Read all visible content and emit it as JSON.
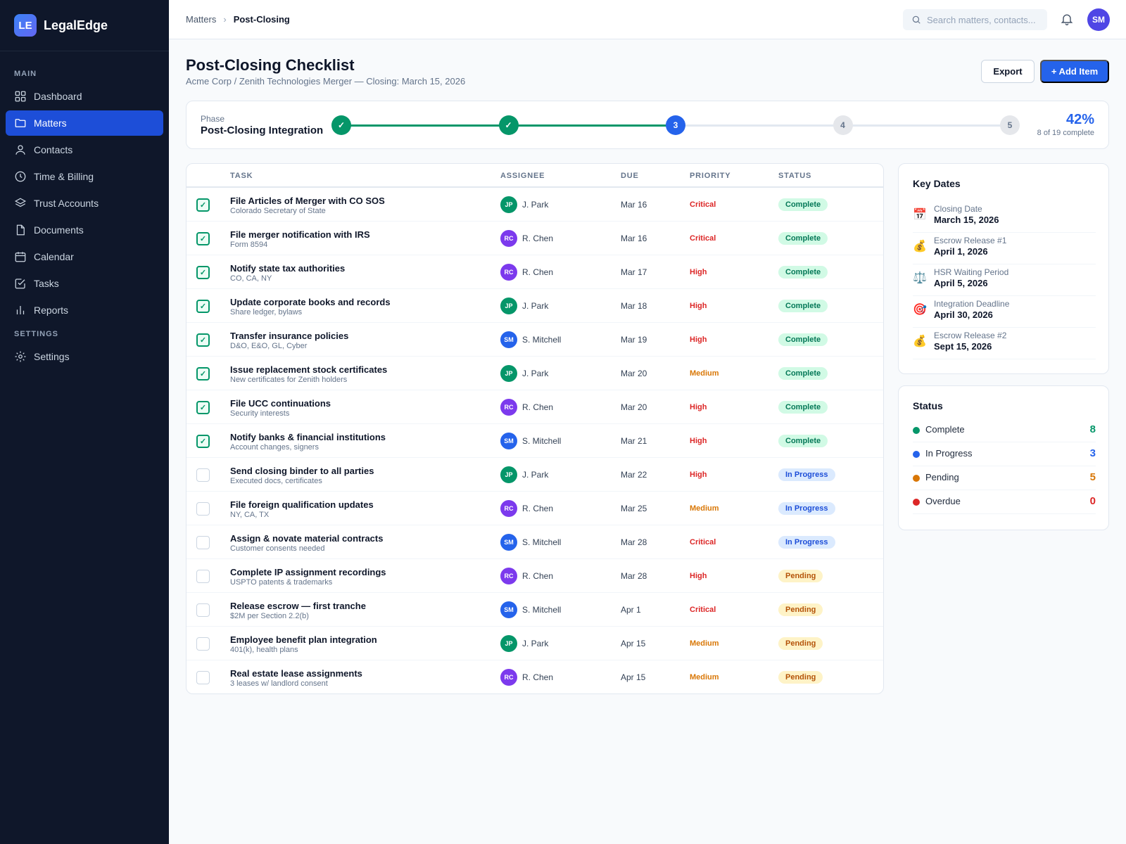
{
  "app": {
    "logo": "LE",
    "name": "LegalEdge"
  },
  "sidebar": {
    "main_heading": "MAIN",
    "settings_heading": "SETTINGS",
    "items": [
      {
        "label": "Dashboard",
        "icon": "dashboard-icon",
        "active": false
      },
      {
        "label": "Matters",
        "icon": "folder-icon",
        "active": true
      },
      {
        "label": "Contacts",
        "icon": "user-icon",
        "active": false
      },
      {
        "label": "Time & Billing",
        "icon": "clock-icon",
        "active": false
      },
      {
        "label": "Trust Accounts",
        "icon": "layers-icon",
        "active": false
      },
      {
        "label": "Documents",
        "icon": "document-icon",
        "active": false
      },
      {
        "label": "Calendar",
        "icon": "calendar-icon",
        "active": false
      },
      {
        "label": "Tasks",
        "icon": "checkbox-icon",
        "active": false
      },
      {
        "label": "Reports",
        "icon": "bar-chart-icon",
        "active": false
      }
    ],
    "settings_items": [
      {
        "label": "Settings",
        "icon": "gear-icon",
        "active": false
      }
    ]
  },
  "topbar": {
    "breadcrumb": [
      "Matters",
      "Post-Closing"
    ],
    "search_placeholder": "Search matters, contacts...",
    "user_initials": "SM"
  },
  "page": {
    "title": "Post-Closing Checklist",
    "subtitle": "Acme Corp / Zenith Technologies Merger — Closing: March 15, 2026",
    "export_label": "Export",
    "add_label": "+ Add Item"
  },
  "phase": {
    "label": "Phase",
    "name": "Post-Closing Integration",
    "steps": [
      {
        "label": "✓",
        "state": "done"
      },
      {
        "label": "✓",
        "state": "done"
      },
      {
        "label": "3",
        "state": "current"
      },
      {
        "label": "4",
        "state": "todo"
      },
      {
        "label": "5",
        "state": "todo"
      }
    ],
    "percent": "42%",
    "count_text": "8 of 19 complete"
  },
  "table": {
    "headers": {
      "task": "TASK",
      "assignee": "ASSIGNEE",
      "due": "DUE",
      "priority": "PRIORITY",
      "status": "STATUS"
    },
    "rows": [
      {
        "checked": true,
        "title": "File Articles of Merger with CO SOS",
        "sub": "Colorado Secretary of State",
        "initials": "JP",
        "assignee": "J. Park",
        "due": "Mar 16",
        "priority": "Critical",
        "status": "Complete"
      },
      {
        "checked": true,
        "title": "File merger notification with IRS",
        "sub": "Form 8594",
        "initials": "RC",
        "assignee": "R. Chen",
        "due": "Mar 16",
        "priority": "Critical",
        "status": "Complete"
      },
      {
        "checked": true,
        "title": "Notify state tax authorities",
        "sub": "CO, CA, NY",
        "initials": "RC",
        "assignee": "R. Chen",
        "due": "Mar 17",
        "priority": "High",
        "status": "Complete"
      },
      {
        "checked": true,
        "title": "Update corporate books and records",
        "sub": "Share ledger, bylaws",
        "initials": "JP",
        "assignee": "J. Park",
        "due": "Mar 18",
        "priority": "High",
        "status": "Complete"
      },
      {
        "checked": true,
        "title": "Transfer insurance policies",
        "sub": "D&O, E&O, GL, Cyber",
        "initials": "SM",
        "assignee": "S. Mitchell",
        "due": "Mar 19",
        "priority": "High",
        "status": "Complete"
      },
      {
        "checked": true,
        "title": "Issue replacement stock certificates",
        "sub": "New certificates for Zenith holders",
        "initials": "JP",
        "assignee": "J. Park",
        "due": "Mar 20",
        "priority": "Medium",
        "status": "Complete"
      },
      {
        "checked": true,
        "title": "File UCC continuations",
        "sub": "Security interests",
        "initials": "RC",
        "assignee": "R. Chen",
        "due": "Mar 20",
        "priority": "High",
        "status": "Complete"
      },
      {
        "checked": true,
        "title": "Notify banks & financial institutions",
        "sub": "Account changes, signers",
        "initials": "SM",
        "assignee": "S. Mitchell",
        "due": "Mar 21",
        "priority": "High",
        "status": "Complete"
      },
      {
        "checked": false,
        "title": "Send closing binder to all parties",
        "sub": "Executed docs, certificates",
        "initials": "JP",
        "assignee": "J. Park",
        "due": "Mar 22",
        "priority": "High",
        "status": "In Progress"
      },
      {
        "checked": false,
        "title": "File foreign qualification updates",
        "sub": "NY, CA, TX",
        "initials": "RC",
        "assignee": "R. Chen",
        "due": "Mar 25",
        "priority": "Medium",
        "status": "In Progress"
      },
      {
        "checked": false,
        "title": "Assign & novate material contracts",
        "sub": "Customer consents needed",
        "initials": "SM",
        "assignee": "S. Mitchell",
        "due": "Mar 28",
        "priority": "Critical",
        "status": "In Progress"
      },
      {
        "checked": false,
        "title": "Complete IP assignment recordings",
        "sub": "USPTO patents & trademarks",
        "initials": "RC",
        "assignee": "R. Chen",
        "due": "Mar 28",
        "priority": "High",
        "status": "Pending"
      },
      {
        "checked": false,
        "title": "Release escrow — first tranche",
        "sub": "$2M per Section 2.2(b)",
        "initials": "SM",
        "assignee": "S. Mitchell",
        "due": "Apr 1",
        "priority": "Critical",
        "status": "Pending"
      },
      {
        "checked": false,
        "title": "Employee benefit plan integration",
        "sub": "401(k), health plans",
        "initials": "JP",
        "assignee": "J. Park",
        "due": "Apr 15",
        "priority": "Medium",
        "status": "Pending"
      },
      {
        "checked": false,
        "title": "Real estate lease assignments",
        "sub": "3 leases w/ landlord consent",
        "initials": "RC",
        "assignee": "R. Chen",
        "due": "Apr 15",
        "priority": "Medium",
        "status": "Pending"
      }
    ]
  },
  "key_dates": {
    "title": "Key Dates",
    "items": [
      {
        "icon": "calendar-emoji-icon",
        "glyph": "📅",
        "label": "Closing Date",
        "date": "March 15, 2026"
      },
      {
        "icon": "money-bag-icon",
        "glyph": "💰",
        "label": "Escrow Release #1",
        "date": "April 1, 2026"
      },
      {
        "icon": "scales-icon",
        "glyph": "⚖️",
        "label": "HSR Waiting Period",
        "date": "April 5, 2026"
      },
      {
        "icon": "target-icon",
        "glyph": "🎯",
        "label": "Integration Deadline",
        "date": "April 30, 2026"
      },
      {
        "icon": "money-bag-icon",
        "glyph": "💰",
        "label": "Escrow Release #2",
        "date": "Sept 15, 2026"
      }
    ]
  },
  "status_summary": {
    "title": "Status",
    "items": [
      {
        "label": "Complete",
        "count": "8",
        "color": "#059669"
      },
      {
        "label": "In Progress",
        "count": "3",
        "color": "#2563eb"
      },
      {
        "label": "Pending",
        "count": "5",
        "color": "#d97706"
      },
      {
        "label": "Overdue",
        "count": "0",
        "color": "#dc2626"
      }
    ]
  },
  "colors": {
    "accent": "#2563eb",
    "sidebar_bg": "#0f172a",
    "avatar_JP": "#059669",
    "avatar_RC": "#7c3aed",
    "avatar_SM": "#2563eb",
    "priority_Critical": "#dc2626",
    "priority_High": "#dc2626",
    "priority_Medium": "#d97706"
  }
}
